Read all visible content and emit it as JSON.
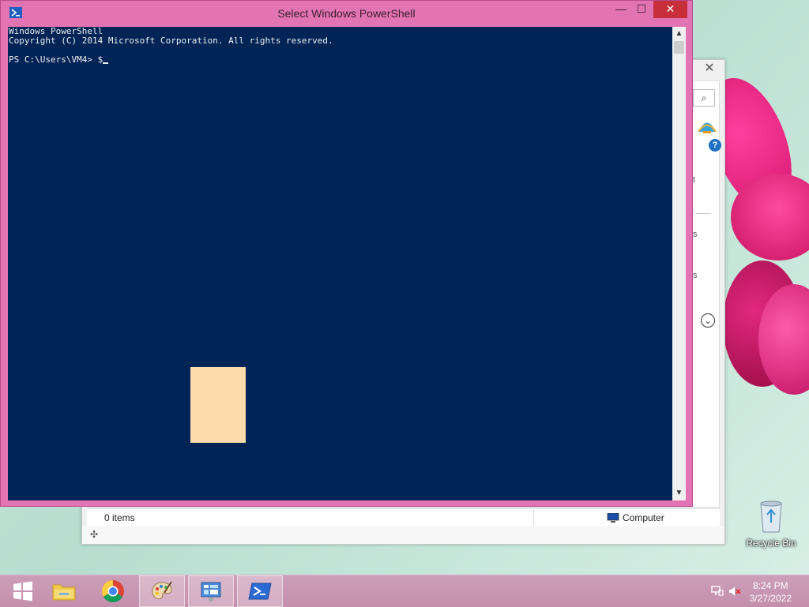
{
  "powershell": {
    "title": "Select Windows PowerShell",
    "console_lines": [
      "Windows PowerShell",
      "Copyright (C) 2014 Microsoft Corporation. All rights reserved.",
      "",
      "PS C:\\Users\\VM4> $"
    ],
    "buttons": {
      "minimize": "—",
      "maximize": "☐",
      "close": "✕"
    },
    "colors": {
      "frame": "#e374b4",
      "console_bg": "#012456",
      "console_fg": "#eeedf0"
    }
  },
  "explorer": {
    "status_items": "0 items",
    "status_location": "Computer",
    "close_symbol": "✕",
    "side_fragments": [
      "t",
      "s",
      "s"
    ],
    "help_symbol": "?",
    "search_symbol": "⌕",
    "expand_symbol": "⌄"
  },
  "desktop": {
    "recycle_bin_label": "Recycle Bin"
  },
  "taskbar": {
    "items": [
      {
        "name": "start-button",
        "icon": "windows-logo-icon"
      },
      {
        "name": "file-explorer",
        "icon": "folder-icon"
      },
      {
        "name": "chrome",
        "icon": "chrome-icon"
      },
      {
        "name": "paint",
        "icon": "paint-palette-icon"
      },
      {
        "name": "control-panel",
        "icon": "control-panel-icon"
      },
      {
        "name": "powershell",
        "icon": "powershell-icon"
      }
    ],
    "clock_time": "8:24 PM",
    "clock_date": "3/27/2022"
  }
}
